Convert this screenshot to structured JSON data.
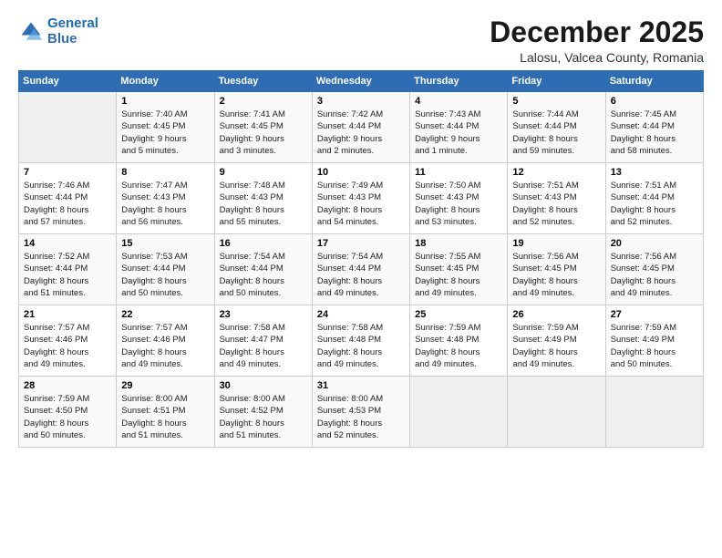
{
  "logo": {
    "line1": "General",
    "line2": "Blue"
  },
  "title": "December 2025",
  "subtitle": "Lalosu, Valcea County, Romania",
  "days_of_week": [
    "Sunday",
    "Monday",
    "Tuesday",
    "Wednesday",
    "Thursday",
    "Friday",
    "Saturday"
  ],
  "weeks": [
    [
      {
        "day": "",
        "info": ""
      },
      {
        "day": "1",
        "info": "Sunrise: 7:40 AM\nSunset: 4:45 PM\nDaylight: 9 hours\nand 5 minutes."
      },
      {
        "day": "2",
        "info": "Sunrise: 7:41 AM\nSunset: 4:45 PM\nDaylight: 9 hours\nand 3 minutes."
      },
      {
        "day": "3",
        "info": "Sunrise: 7:42 AM\nSunset: 4:44 PM\nDaylight: 9 hours\nand 2 minutes."
      },
      {
        "day": "4",
        "info": "Sunrise: 7:43 AM\nSunset: 4:44 PM\nDaylight: 9 hours\nand 1 minute."
      },
      {
        "day": "5",
        "info": "Sunrise: 7:44 AM\nSunset: 4:44 PM\nDaylight: 8 hours\nand 59 minutes."
      },
      {
        "day": "6",
        "info": "Sunrise: 7:45 AM\nSunset: 4:44 PM\nDaylight: 8 hours\nand 58 minutes."
      }
    ],
    [
      {
        "day": "7",
        "info": "Sunrise: 7:46 AM\nSunset: 4:44 PM\nDaylight: 8 hours\nand 57 minutes."
      },
      {
        "day": "8",
        "info": "Sunrise: 7:47 AM\nSunset: 4:43 PM\nDaylight: 8 hours\nand 56 minutes."
      },
      {
        "day": "9",
        "info": "Sunrise: 7:48 AM\nSunset: 4:43 PM\nDaylight: 8 hours\nand 55 minutes."
      },
      {
        "day": "10",
        "info": "Sunrise: 7:49 AM\nSunset: 4:43 PM\nDaylight: 8 hours\nand 54 minutes."
      },
      {
        "day": "11",
        "info": "Sunrise: 7:50 AM\nSunset: 4:43 PM\nDaylight: 8 hours\nand 53 minutes."
      },
      {
        "day": "12",
        "info": "Sunrise: 7:51 AM\nSunset: 4:43 PM\nDaylight: 8 hours\nand 52 minutes."
      },
      {
        "day": "13",
        "info": "Sunrise: 7:51 AM\nSunset: 4:44 PM\nDaylight: 8 hours\nand 52 minutes."
      }
    ],
    [
      {
        "day": "14",
        "info": "Sunrise: 7:52 AM\nSunset: 4:44 PM\nDaylight: 8 hours\nand 51 minutes."
      },
      {
        "day": "15",
        "info": "Sunrise: 7:53 AM\nSunset: 4:44 PM\nDaylight: 8 hours\nand 50 minutes."
      },
      {
        "day": "16",
        "info": "Sunrise: 7:54 AM\nSunset: 4:44 PM\nDaylight: 8 hours\nand 50 minutes."
      },
      {
        "day": "17",
        "info": "Sunrise: 7:54 AM\nSunset: 4:44 PM\nDaylight: 8 hours\nand 49 minutes."
      },
      {
        "day": "18",
        "info": "Sunrise: 7:55 AM\nSunset: 4:45 PM\nDaylight: 8 hours\nand 49 minutes."
      },
      {
        "day": "19",
        "info": "Sunrise: 7:56 AM\nSunset: 4:45 PM\nDaylight: 8 hours\nand 49 minutes."
      },
      {
        "day": "20",
        "info": "Sunrise: 7:56 AM\nSunset: 4:45 PM\nDaylight: 8 hours\nand 49 minutes."
      }
    ],
    [
      {
        "day": "21",
        "info": "Sunrise: 7:57 AM\nSunset: 4:46 PM\nDaylight: 8 hours\nand 49 minutes."
      },
      {
        "day": "22",
        "info": "Sunrise: 7:57 AM\nSunset: 4:46 PM\nDaylight: 8 hours\nand 49 minutes."
      },
      {
        "day": "23",
        "info": "Sunrise: 7:58 AM\nSunset: 4:47 PM\nDaylight: 8 hours\nand 49 minutes."
      },
      {
        "day": "24",
        "info": "Sunrise: 7:58 AM\nSunset: 4:48 PM\nDaylight: 8 hours\nand 49 minutes."
      },
      {
        "day": "25",
        "info": "Sunrise: 7:59 AM\nSunset: 4:48 PM\nDaylight: 8 hours\nand 49 minutes."
      },
      {
        "day": "26",
        "info": "Sunrise: 7:59 AM\nSunset: 4:49 PM\nDaylight: 8 hours\nand 49 minutes."
      },
      {
        "day": "27",
        "info": "Sunrise: 7:59 AM\nSunset: 4:49 PM\nDaylight: 8 hours\nand 50 minutes."
      }
    ],
    [
      {
        "day": "28",
        "info": "Sunrise: 7:59 AM\nSunset: 4:50 PM\nDaylight: 8 hours\nand 50 minutes."
      },
      {
        "day": "29",
        "info": "Sunrise: 8:00 AM\nSunset: 4:51 PM\nDaylight: 8 hours\nand 51 minutes."
      },
      {
        "day": "30",
        "info": "Sunrise: 8:00 AM\nSunset: 4:52 PM\nDaylight: 8 hours\nand 51 minutes."
      },
      {
        "day": "31",
        "info": "Sunrise: 8:00 AM\nSunset: 4:53 PM\nDaylight: 8 hours\nand 52 minutes."
      },
      {
        "day": "",
        "info": ""
      },
      {
        "day": "",
        "info": ""
      },
      {
        "day": "",
        "info": ""
      }
    ]
  ]
}
